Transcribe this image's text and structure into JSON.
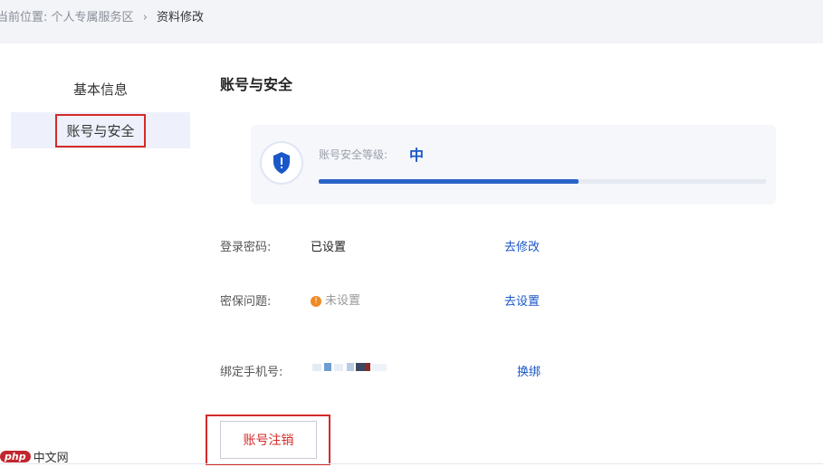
{
  "breadcrumb": {
    "prefix": "当前位置:",
    "parent": "个人专属服务区",
    "separator": "›",
    "current": "资料修改"
  },
  "sidebar": {
    "items": [
      {
        "label": "基本信息"
      },
      {
        "label": "账号与安全",
        "active": true
      }
    ]
  },
  "main": {
    "title": "账号与安全",
    "security_level": {
      "label": "账号安全等级:",
      "value": "中",
      "progress": 0.58
    },
    "rows": [
      {
        "label": "登录密码:",
        "value": "已设置",
        "action": "去修改"
      },
      {
        "label": "密保问题:",
        "value": "未设置",
        "action": "去设置",
        "status_icon": "warning-icon"
      },
      {
        "label": "绑定手机号:",
        "value": "",
        "action": "换绑"
      }
    ],
    "cancel_button": "账号注销"
  },
  "watermark": {
    "badge": "php",
    "text": "中文网"
  },
  "colors": {
    "accent": "#1a57c8",
    "highlight_border": "#d42a2a",
    "warning": "#f08a24",
    "topbar_bg": "#f3f4f8",
    "sidebar_active_bg": "#eef1fb"
  }
}
